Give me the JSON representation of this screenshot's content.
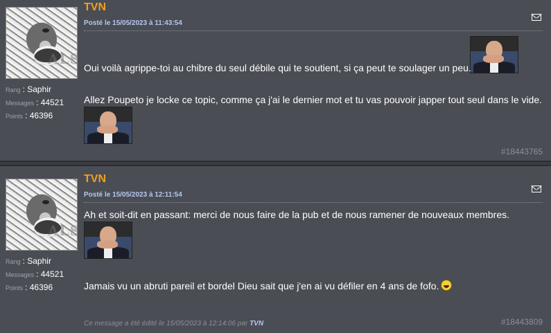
{
  "posts": [
    {
      "author": "TVN",
      "date": "Posté le 15/05/2023 à 11:43:54",
      "rank_label": "Rang",
      "rank_value": ": Saphir",
      "messages_label": "Messages",
      "messages_value": ": 44521",
      "points_label": "Points",
      "points_value": ": 46396",
      "paragraphs": [
        "Oui voilà agrippe-toi au chibre du seul débile qui te soutient, si ça peut te soulager un peu.",
        "Allez Poupeto je locke ce topic, comme ça j'ai le dernier mot et tu vas pouvoir japper tout seul dans le vide."
      ],
      "post_number": "#18443765"
    },
    {
      "author": "TVN",
      "date": "Posté le 15/05/2023 à 12:11:54",
      "rank_label": "Rang",
      "rank_value": ": Saphir",
      "messages_label": "Messages",
      "messages_value": ": 44521",
      "points_label": "Points",
      "points_value": ": 46396",
      "paragraphs": [
        "Ah et soit-dit en passant: merci de nous faire de la pub et de nous ramener de nouveaux membres.",
        "Jamais vu un abruti pareil et bordel Dieu sait que j'en ai vu défiler en 4 ans de fofo."
      ],
      "edit_prefix": "Ce message a été édité le 15/05/2023 à 12:14:06 par",
      "edit_user": "TVN",
      "post_number": "#18443809"
    }
  ],
  "icons": {
    "message": "envelope-icon",
    "avatar": "wolf-avatar",
    "smiley": "laughing-smiley",
    "emoji": "laughing-emoji"
  },
  "colors": {
    "author": "#f0a020",
    "date": "#b6c6f0",
    "background": "#4a4d54"
  }
}
